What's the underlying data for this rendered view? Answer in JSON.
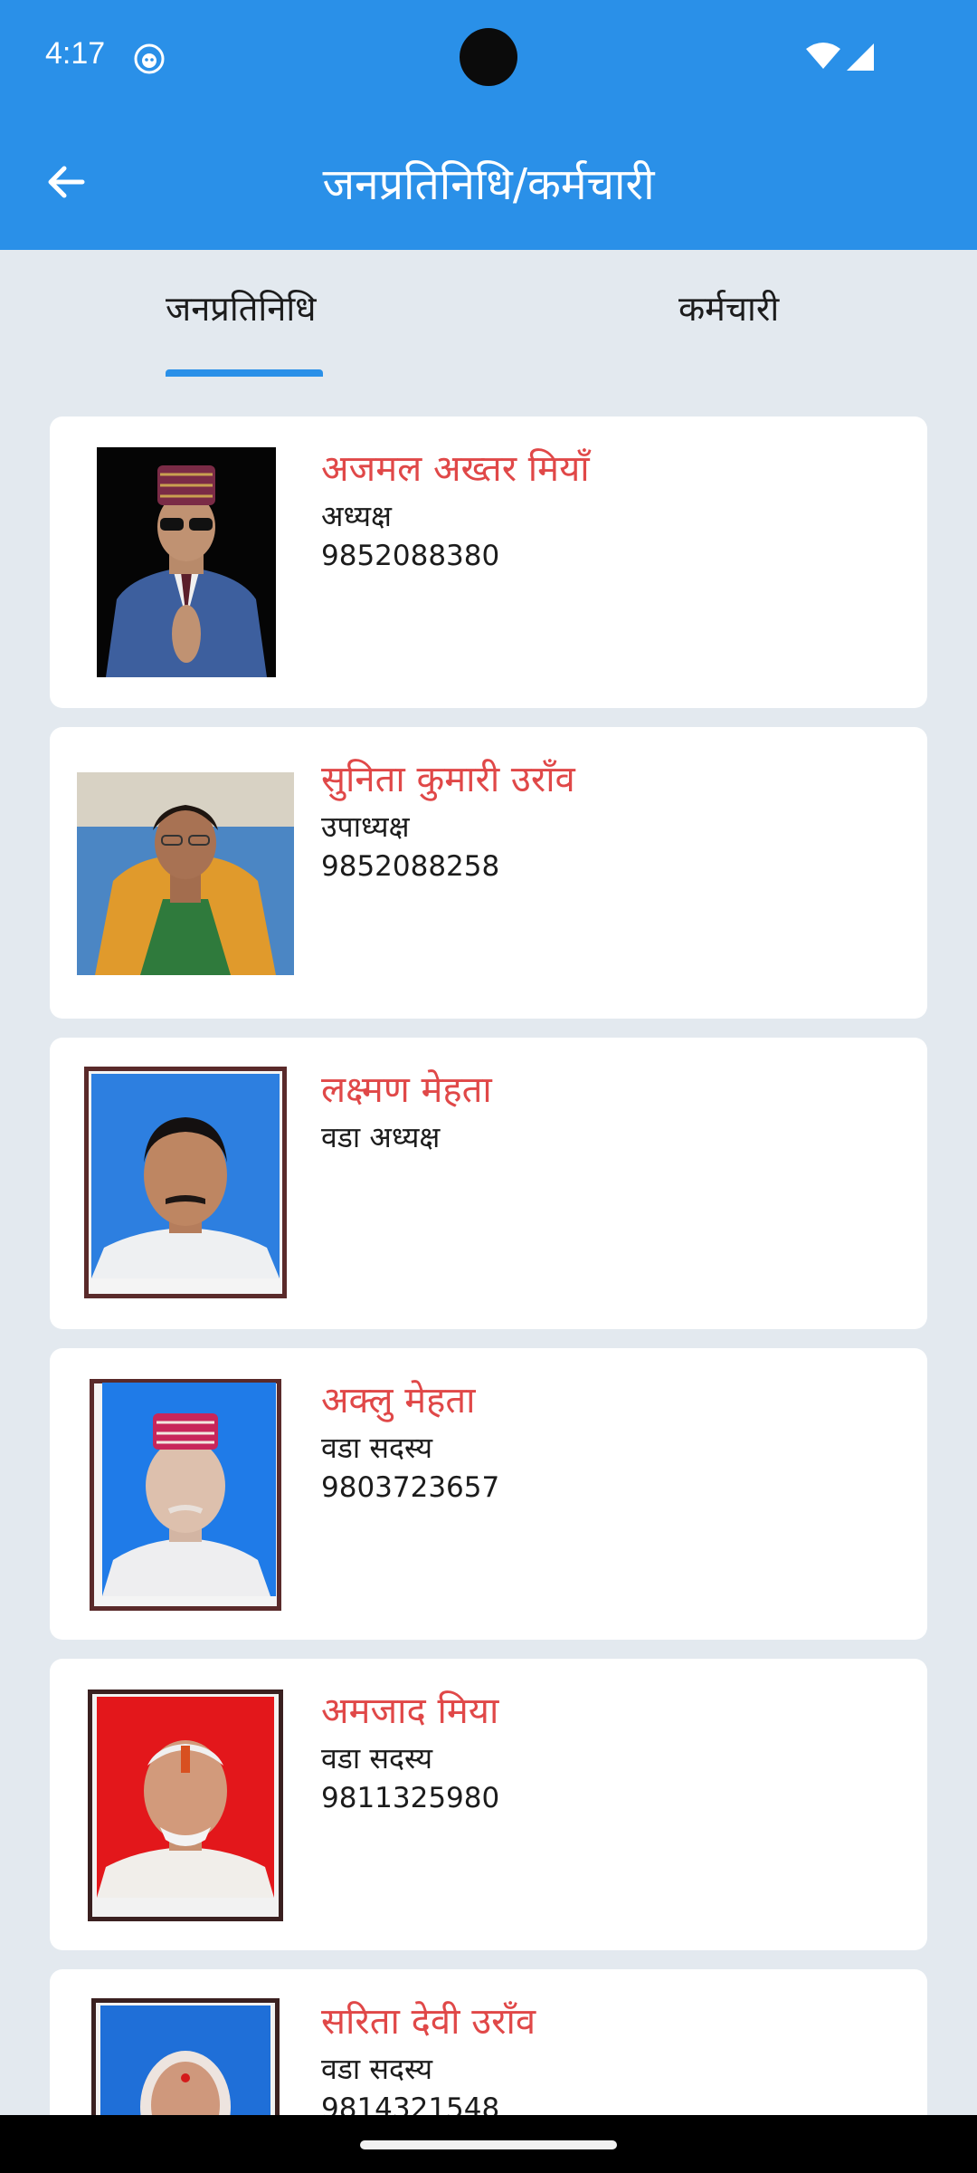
{
  "status_bar": {
    "time": "4:17"
  },
  "app_bar": {
    "title": "जनप्रतिनिधि/कर्मचारी"
  },
  "tabs": [
    {
      "label": "जनप्रतिनिधि",
      "selected": true
    },
    {
      "label": "कर्मचारी",
      "selected": false
    }
  ],
  "representatives": [
    {
      "name": "अजमल अख्तर मियाँ",
      "role": "अध्यक्ष",
      "phone": "9852088380"
    },
    {
      "name": "सुनिता कुमारी उराँव",
      "role": "उपाध्यक्ष",
      "phone": "9852088258"
    },
    {
      "name": "लक्ष्मण मेहता",
      "role": "वडा अध्यक्ष",
      "phone": ""
    },
    {
      "name": "अक्लु मेहता",
      "role": "वडा सदस्य",
      "phone": "9803723657"
    },
    {
      "name": "अमजाद मिया",
      "role": "वडा सदस्य",
      "phone": "9811325980"
    },
    {
      "name": "सरिता देवी उराँव",
      "role": "वडा सदस्य",
      "phone": "9814321548"
    }
  ],
  "colors": {
    "primary": "#2a90e8",
    "name_text": "#e04848",
    "background": "#e3e9ef",
    "card": "#ffffff"
  }
}
